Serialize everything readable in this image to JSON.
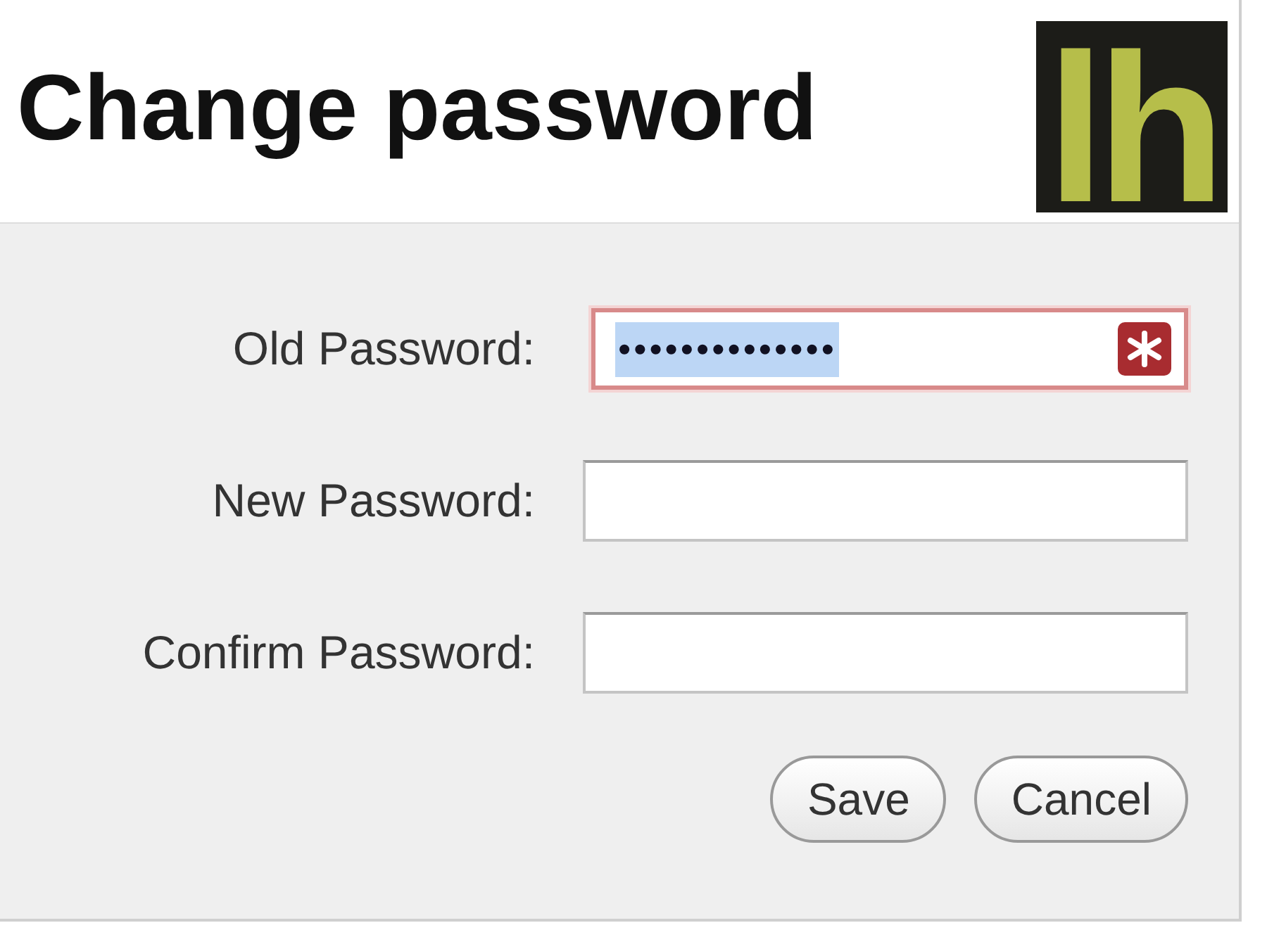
{
  "dialog": {
    "title": "Change password",
    "logo": "lh"
  },
  "fields": [
    {
      "label": "Old Password:",
      "value": "••••••••••••••",
      "text_selected": true,
      "error": true
    },
    {
      "label": "New Password:",
      "error": false
    },
    {
      "label": "Confirm Password:",
      "error": false
    }
  ],
  "buttons": [
    "Save",
    "Cancel"
  ]
}
